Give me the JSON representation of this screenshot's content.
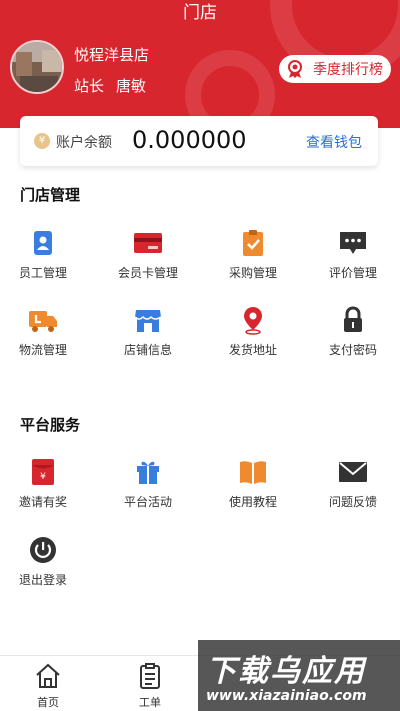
{
  "header": {
    "title": "门店",
    "store_name": "悦程洋县店",
    "role": "站长",
    "staff_name": "唐敏",
    "rank_button": "季度排行榜"
  },
  "balance": {
    "coin_symbol": "¥",
    "label": "账户余额",
    "value": "0.000000",
    "wallet_link": "查看钱包"
  },
  "store_management": {
    "title": "门店管理",
    "items": [
      {
        "label": "员工管理",
        "icon": "employee-badge-icon"
      },
      {
        "label": "会员卡管理",
        "icon": "member-card-icon"
      },
      {
        "label": "采购管理",
        "icon": "clipboard-check-icon"
      },
      {
        "label": "评价管理",
        "icon": "chat-bubble-icon"
      },
      {
        "label": "物流管理",
        "icon": "truck-icon"
      },
      {
        "label": "店铺信息",
        "icon": "storefront-icon"
      },
      {
        "label": "发货地址",
        "icon": "location-pin-icon"
      },
      {
        "label": "支付密码",
        "icon": "lock-icon"
      }
    ]
  },
  "platform_services": {
    "title": "平台服务",
    "items": [
      {
        "label": "邀请有奖",
        "icon": "red-envelope-icon"
      },
      {
        "label": "平台活动",
        "icon": "gift-icon"
      },
      {
        "label": "使用教程",
        "icon": "open-book-icon"
      },
      {
        "label": "问题反馈",
        "icon": "mail-icon"
      },
      {
        "label": "退出登录",
        "icon": "power-icon"
      }
    ]
  },
  "tabbar": {
    "tabs": [
      {
        "label": "首页",
        "icon": "home-icon"
      },
      {
        "label": "工单",
        "icon": "clipboard-icon"
      }
    ]
  },
  "watermark": {
    "line1": "下载乌应用",
    "line2": "www.xiazainiao.com"
  },
  "colors": {
    "brand_red": "#d8262e",
    "link_blue": "#2c6fd3",
    "icon_orange": "#f08a2e",
    "icon_blue": "#3a7de0"
  }
}
